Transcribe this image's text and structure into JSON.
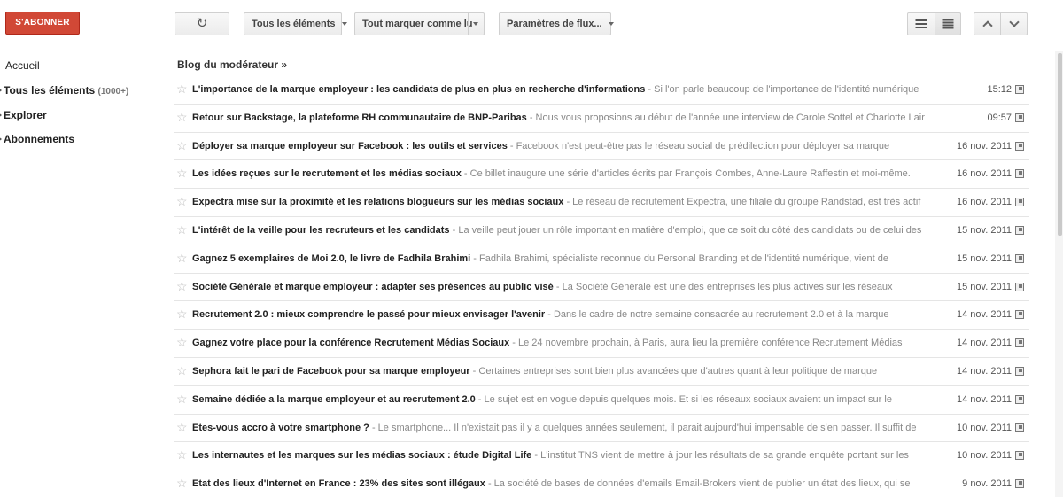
{
  "toolbar": {
    "subscribe_label": "S'ABONNER",
    "refresh_glyph": "↻",
    "all_items_label": "Tous les éléments",
    "mark_all_read_label": "Tout marquer comme lu",
    "feed_settings_label": "Paramètres de flux...",
    "view_list_icon": "list-view-icon",
    "view_expanded_icon": "expanded-view-icon",
    "prev_icon": "chevron-up-icon",
    "next_icon": "chevron-down-icon"
  },
  "sidebar": {
    "home_label": "Accueil",
    "all_items_label": "Tous les éléments",
    "all_items_count": "(1000+)",
    "explore_label": "Explorer",
    "subscriptions_label": "Abonnements"
  },
  "feed": {
    "title": "Blog du modérateur »",
    "items": [
      {
        "title": "L'importance de la marque employeur : les candidats de plus en plus en recherche d'informations",
        "snippet": " - Si l'on parle beaucoup de l'importance de l'identité numérique",
        "date": "15:12"
      },
      {
        "title": "Retour sur Backstage, la plateforme RH communautaire de BNP-Paribas",
        "snippet": " - Nous vous proposions au début de l'année une interview de Carole Sottel et Charlotte Lair",
        "date": "09:57"
      },
      {
        "title": "Déployer sa marque employeur sur Facebook : les outils et services",
        "snippet": " - Facebook n'est peut-être pas le réseau social de prédilection pour déployer sa marque",
        "date": "16 nov. 2011"
      },
      {
        "title": "Les idées reçues sur le recrutement et les médias sociaux",
        "snippet": " - Ce billet inaugure une série d'articles écrits par François Combes, Anne-Laure Raffestin et moi-même.",
        "date": "16 nov. 2011"
      },
      {
        "title": "Expectra mise sur la proximité et les relations blogueurs sur les médias sociaux",
        "snippet": " - Le réseau de recrutement Expectra, une filiale du groupe Randstad, est très actif",
        "date": "16 nov. 2011"
      },
      {
        "title": "L'intérêt de la veille pour les recruteurs et les candidats",
        "snippet": " - La veille peut jouer un rôle important en matière d'emploi, que ce soit du côté des candidats ou de celui des",
        "date": "15 nov. 2011"
      },
      {
        "title": "Gagnez 5 exemplaires de Moi 2.0, le livre de Fadhila Brahimi",
        "snippet": " - Fadhila Brahimi, spécialiste reconnue du Personal Branding et de l'identité numérique, vient de",
        "date": "15 nov. 2011"
      },
      {
        "title": "Société Générale et marque employeur : adapter ses présences au public visé",
        "snippet": " - La Société Générale est une des entreprises les plus actives sur les réseaux",
        "date": "15 nov. 2011"
      },
      {
        "title": "Recrutement 2.0 : mieux comprendre le passé pour mieux envisager l'avenir",
        "snippet": " - Dans le cadre de notre semaine consacrée au recrutement 2.0 et à la marque",
        "date": "14 nov. 2011"
      },
      {
        "title": "Gagnez votre place pour la conférence Recrutement Médias Sociaux",
        "snippet": " - Le 24 novembre prochain, à Paris, aura lieu la première conférence Recrutement Médias",
        "date": "14 nov. 2011"
      },
      {
        "title": "Sephora fait le pari de Facebook pour sa marque employeur",
        "snippet": " - Certaines entreprises sont bien plus avancées que d'autres quant à leur politique de marque",
        "date": "14 nov. 2011"
      },
      {
        "title": "Semaine dédiée a la marque employeur et au recrutement 2.0",
        "snippet": " - Le sujet est en vogue depuis quelques mois. Et si les réseaux sociaux avaient un impact sur le",
        "date": "14 nov. 2011"
      },
      {
        "title": "Etes-vous accro à votre smartphone ?",
        "snippet": " - Le smartphone... Il n'existait pas il y a quelques années seulement, il parait aujourd'hui impensable de s'en passer. Il suffit de",
        "date": "10 nov. 2011"
      },
      {
        "title": "Les internautes et les marques sur les médias sociaux : étude Digital Life",
        "snippet": " - L'institut TNS vient de mettre à jour les résultats de sa grande enquête portant sur les",
        "date": "10 nov. 2011"
      },
      {
        "title": "Etat des lieux d'Internet en France : 23% des sites sont illégaux",
        "snippet": " - La société de bases de données d'emails Email-Brokers vient de publier un état des lieux, qui se",
        "date": "9 nov. 2011"
      }
    ]
  }
}
